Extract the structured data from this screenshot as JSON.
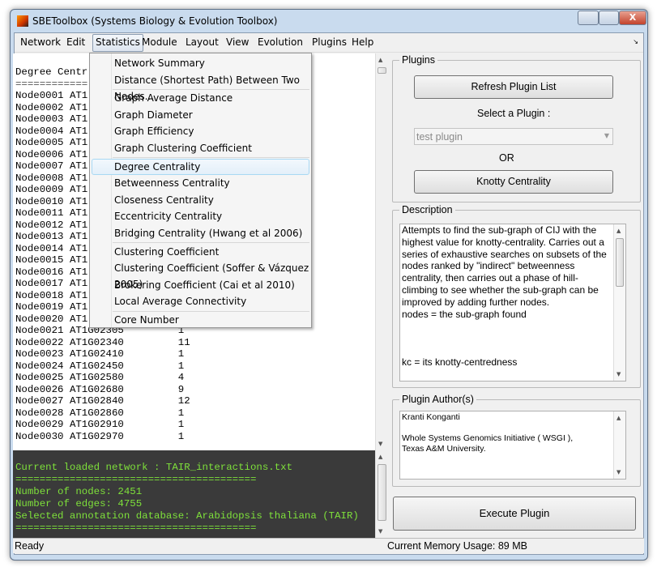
{
  "window": {
    "title": "SBEToolbox (Systems Biology & Evolution Toolbox)",
    "close_label": "X"
  },
  "menubar": [
    "Network",
    "Edit",
    "Statistics",
    "Module",
    "Layout",
    "View",
    "Evolution",
    "Plugins",
    "Help"
  ],
  "statistics_menu": {
    "groups": [
      [
        "Network Summary",
        "Distance (Shortest Path) Between Two Nodes..."
      ],
      [
        "Graph Average Distance",
        "Graph Diameter",
        "Graph Efficiency",
        "Graph Clustering Coefficient"
      ],
      [
        "Degree Centrality",
        "Betweenness Centrality",
        "Closeness Centrality",
        "Eccentricity Centrality",
        "Bridging Centrality (Hwang et al 2006)"
      ],
      [
        "Clustering Coefficient",
        "Clustering Coefficient (Soffer & Vázquez 2005)",
        "Brokering Coefficient (Cai et al 2010)",
        "Local Average Connectivity"
      ],
      [
        "Core Number"
      ]
    ],
    "highlighted": "Degree Centrality"
  },
  "output": {
    "header": "Degree Centr",
    "rule": "============",
    "rows": [
      [
        "Node0001",
        "AT1",
        ""
      ],
      [
        "Node0002",
        "AT1",
        ""
      ],
      [
        "Node0003",
        "AT1",
        ""
      ],
      [
        "Node0004",
        "AT1",
        ""
      ],
      [
        "Node0005",
        "AT1",
        ""
      ],
      [
        "Node0006",
        "AT1",
        ""
      ],
      [
        "Node0007",
        "AT1",
        ""
      ],
      [
        "Node0008",
        "AT1",
        ""
      ],
      [
        "Node0009",
        "AT1",
        ""
      ],
      [
        "Node0010",
        "AT1",
        ""
      ],
      [
        "Node0011",
        "AT1",
        ""
      ],
      [
        "Node0012",
        "AT1",
        ""
      ],
      [
        "Node0013",
        "AT1",
        ""
      ],
      [
        "Node0014",
        "AT1",
        ""
      ],
      [
        "Node0015",
        "AT1",
        ""
      ],
      [
        "Node0016",
        "AT1",
        ""
      ],
      [
        "Node0017",
        "AT1",
        ""
      ],
      [
        "Node0018",
        "AT1",
        ""
      ],
      [
        "Node0019",
        "AT1",
        ""
      ],
      [
        "Node0020",
        "AT1",
        ""
      ],
      [
        "Node0021",
        "AT1G02305",
        "1"
      ],
      [
        "Node0022",
        "AT1G02340",
        "11"
      ],
      [
        "Node0023",
        "AT1G02410",
        "1"
      ],
      [
        "Node0024",
        "AT1G02450",
        "1"
      ],
      [
        "Node0025",
        "AT1G02580",
        "4"
      ],
      [
        "Node0026",
        "AT1G02680",
        "9"
      ],
      [
        "Node0027",
        "AT1G02840",
        "12"
      ],
      [
        "Node0028",
        "AT1G02860",
        "1"
      ],
      [
        "Node0029",
        "AT1G02910",
        "1"
      ],
      [
        "Node0030",
        "AT1G02970",
        "1"
      ]
    ]
  },
  "console": {
    "lines": [
      "Current loaded network : TAIR_interactions.txt",
      "========================================",
      "Number of nodes: 2451",
      "Number of edges: 4755",
      "Selected annotation database: Arabidopsis thaliana (TAIR)",
      "========================================"
    ],
    "text_color": "#7ee03a"
  },
  "status": {
    "left": "Ready",
    "memory": "Current Memory Usage: 89 MB"
  },
  "plugins": {
    "group_label": "Plugins",
    "refresh_label": "Refresh Plugin List",
    "select_label": "Select a Plugin  :",
    "selected_plugin": "test plugin",
    "or_label": "OR",
    "knotty_label": "Knotty Centrality"
  },
  "description": {
    "group_label": "Description",
    "text": "Attempts to find the sub-graph of CIJ with the highest value for knotty-centrality. Carries out a series of exhaustive searches on subsets of the nodes ranked by \"indirect\" betweenness centrality, then carries out a phase of hill-climbing to see whether the sub-graph can be improved by adding further nodes.\nnodes = the sub-graph found\n\n\n\nkc = its knotty-centredness"
  },
  "authors": {
    "group_label": "Plugin Author(s)",
    "text": "Kranti Konganti\n\nWhole Systems Genomics Initiative ( WSGI ),\nTexas A&M University."
  },
  "execute_label": "Execute Plugin"
}
